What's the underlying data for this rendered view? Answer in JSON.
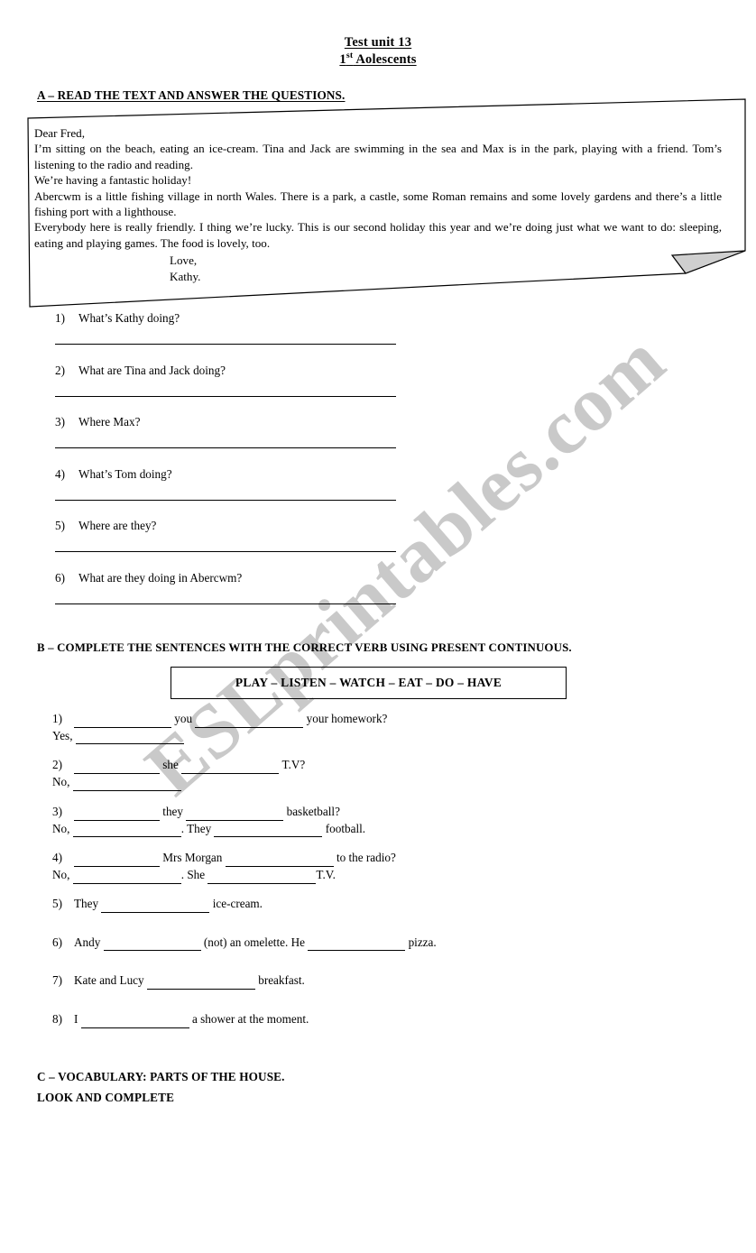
{
  "document": {
    "title_line_1": "Test unit 13",
    "title_line_2_prefix": "1",
    "title_line_2_sup": "st",
    "title_line_2_rest": " Aolescents",
    "watermark": "ESLprintables.com",
    "watermark_color": "#c9c9c9"
  },
  "section_a": {
    "heading": "A – READ THE TEXT AND ANSWER THE QUESTIONS.",
    "letter": {
      "line_1": "Dear Fred,",
      "line_2": "I’m sitting on the beach, eating an ice-cream. Tina and Jack are swimming in the sea and Max is in the park, playing with a friend. Tom’s listening to the radio and reading.",
      "line_3": "We’re having a fantastic holiday!",
      "line_4": "Abercwm is a little fishing village in north Wales. There is a park, a castle, some Roman remains and some lovely gardens and there’s a little fishing port with a lighthouse.",
      "line_5": "Everybody here is really friendly.  I thing we’re lucky.  This is our second holiday this year and we’re doing just what we want to do: sleeping, eating and playing games. The food is lovely, too.",
      "signoff": "Love,",
      "signature": "Kathy."
    },
    "questions": [
      {
        "num": "1)",
        "text": "What’s Kathy doing?"
      },
      {
        "num": "2)",
        "text": "What are Tina and Jack doing?"
      },
      {
        "num": "3)",
        "text": "Where Max?"
      },
      {
        "num": "4)",
        "text": "What’s Tom doing?"
      },
      {
        "num": "5)",
        "text": "Where are they?"
      },
      {
        "num": "6)",
        "text": "What are they doing in Abercwm?"
      }
    ]
  },
  "section_b": {
    "heading": "B – COMPLETE THE SENTENCES WITH THE CORRECT VERB USING PRESENT CONTINUOUS.",
    "word_bank": "PLAY – LISTEN – WATCH – EAT – DO – HAVE",
    "items": {
      "i1_num": "1)",
      "i1_mid": "you",
      "i1_end": "your homework?",
      "i1_answer_prefix": "Yes,",
      "i2_num": "2)",
      "i2_mid": "she",
      "i2_end": "T.V?",
      "i2_answer_prefix": "No,",
      "i3_num": "3)",
      "i3_mid": "they",
      "i3_end": "basketball?",
      "i3_answer_prefix": "No,",
      "i3_answer_mid": ". They",
      "i3_answer_end": "football.",
      "i4_num": "4)",
      "i4_mid": "Mrs Morgan",
      "i4_end": "to the radio?",
      "i4_answer_prefix": "No,",
      "i4_answer_mid": ". She",
      "i4_answer_end": "T.V.",
      "i5_num": "5)",
      "i5_start": "They",
      "i5_end": "ice-cream.",
      "i6_num": "6)",
      "i6_start": "Andy",
      "i6_mid": "(not) an omelette. He",
      "i6_end": "pizza.",
      "i7_num": "7)",
      "i7_start": "Kate and Lucy",
      "i7_end": "breakfast.",
      "i8_num": "8)",
      "i8_start": "I",
      "i8_end": "a shower at the moment."
    }
  },
  "section_c": {
    "heading_line_1": "C – VOCABULARY: PARTS OF THE HOUSE.",
    "heading_line_2": "LOOK AND COMPLETE"
  }
}
